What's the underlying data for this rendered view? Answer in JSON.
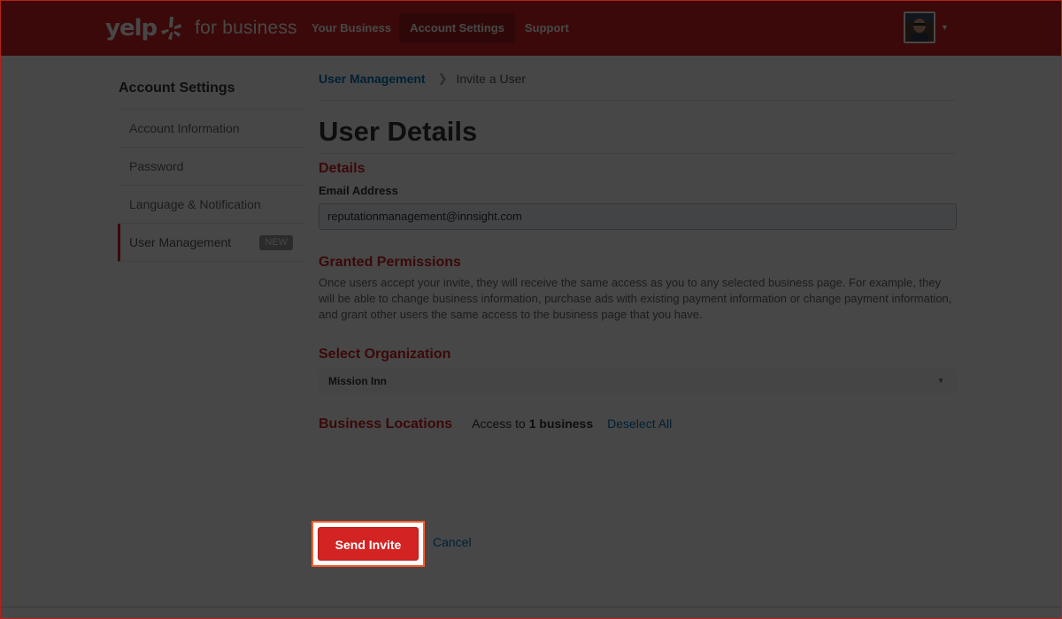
{
  "header": {
    "logo_word": "yelp",
    "logo_suffix": "for business",
    "nav": [
      "Your Business",
      "Account Settings",
      "Support"
    ],
    "active_nav": "Account Settings"
  },
  "sidebar": {
    "title": "Account Settings",
    "items": [
      {
        "label": "Account Information"
      },
      {
        "label": "Password"
      },
      {
        "label": "Language & Notification"
      },
      {
        "label": "User Management",
        "badge": "NEW",
        "active": true
      }
    ]
  },
  "breadcrumb": {
    "parent": "User Management",
    "current": "Invite a User"
  },
  "main": {
    "title": "User Details",
    "details_heading": "Details",
    "email_label": "Email Address",
    "email_value": "reputationmanagement@innsight.com",
    "permissions_heading": "Granted Permissions",
    "permissions_text": "Once users accept your invite, they will receive the same access as you to any selected business page. For example, they will be able to change business information, purchase ads with existing payment information or change payment information, and grant other users the same access to the business page that you have.",
    "org_heading": "Select Organization",
    "org_selected": "Mission Inn",
    "locations_heading": "Business Locations",
    "access_prefix": "Access to",
    "access_count": "1 business",
    "deselect_all": "Deselect All",
    "send_label": "Send Invite",
    "cancel_label": "Cancel"
  },
  "colors": {
    "brand_red": "#d32323",
    "link_blue": "#0073bb",
    "highlight_outline": "#ff5b2e",
    "dim_overlay": "rgba(0,0,0,0.72)"
  },
  "icons": [
    "yelp-burst-icon",
    "avatar",
    "chevron-right-icon",
    "caret-down-icon"
  ]
}
